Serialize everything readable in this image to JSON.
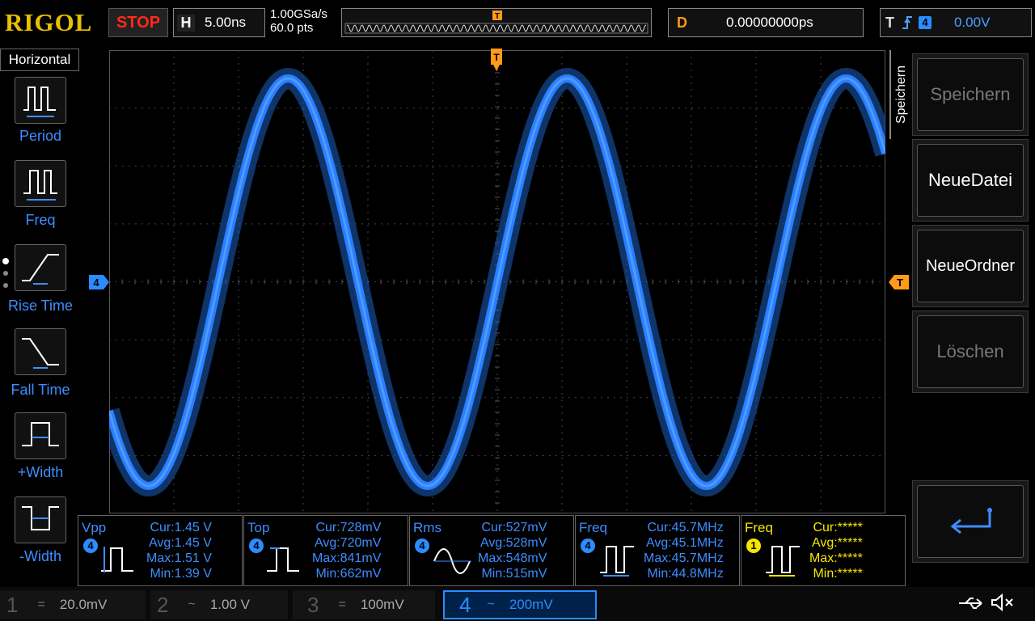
{
  "brand": "RIGOL",
  "run_state": "STOP",
  "horizontal": {
    "letter": "H",
    "timebase": "5.00ns"
  },
  "sample_rate": "1.00GSa/s",
  "memory_depth": "60.0  pts",
  "delay": {
    "letter": "D",
    "value": "0.00000000ps"
  },
  "trigger": {
    "letter": "T",
    "channel": "4",
    "level": "0.00V"
  },
  "left_menu": {
    "title": "Horizontal",
    "items": [
      {
        "label": "Period",
        "icon": "period-icon"
      },
      {
        "label": "Freq",
        "icon": "freq-icon"
      },
      {
        "label": "Rise Time",
        "icon": "rise-time-icon"
      },
      {
        "label": "Fall Time",
        "icon": "fall-time-icon"
      },
      {
        "label": "+Width",
        "icon": "pos-width-icon"
      },
      {
        "label": "-Width",
        "icon": "neg-width-icon"
      }
    ]
  },
  "channel_marker": "4",
  "trigger_marker": "T",
  "right_menu": {
    "title": "Speichern",
    "buttons": [
      {
        "label": "Speichern",
        "enabled": false
      },
      {
        "label": "NeueDatei",
        "enabled": true
      },
      {
        "label": "NeueOrdner",
        "enabled": true
      },
      {
        "label": "Löschen",
        "enabled": false
      }
    ],
    "back_icon": "enter-arrow-icon"
  },
  "measurements": [
    {
      "name": "Vpp",
      "channel": "4",
      "cur": "Cur:1.45 V",
      "avg": "Avg:1.45 V",
      "max": "Max:1.51 V",
      "min": "Min:1.39 V",
      "color": "#3e8dff",
      "icon": "vpp-icon"
    },
    {
      "name": "Top",
      "channel": "4",
      "cur": "Cur:728mV",
      "avg": "Avg:720mV",
      "max": "Max:841mV",
      "min": "Min:662mV",
      "color": "#3e8dff",
      "icon": "top-icon"
    },
    {
      "name": "Rms",
      "channel": "4",
      "cur": "Cur:527mV",
      "avg": "Avg:528mV",
      "max": "Max:548mV",
      "min": "Min:515mV",
      "color": "#3e8dff",
      "icon": "rms-icon"
    },
    {
      "name": "Freq",
      "channel": "4",
      "cur": "Cur:45.7MHz",
      "avg": "Avg:45.1MHz",
      "max": "Max:45.7MHz",
      "min": "Min:44.8MHz",
      "color": "#3e8dff",
      "icon": "freq-icon"
    },
    {
      "name": "Freq",
      "channel": "1",
      "cur": "Cur:*****",
      "avg": "Avg:*****",
      "max": "Max:*****",
      "min": "Min:*****",
      "color": "#f5e600",
      "icon": "freq-icon"
    }
  ],
  "channels": [
    {
      "num": "1",
      "coupling": "=",
      "scale": "20.0mV",
      "color": "#c8c000",
      "active": false
    },
    {
      "num": "2",
      "coupling": "~",
      "scale": "1.00 V",
      "color": "#00c8ff",
      "active": false
    },
    {
      "num": "3",
      "coupling": "=",
      "scale": "100mV",
      "color": "#c050c0",
      "active": false
    },
    {
      "num": "4",
      "coupling": "~",
      "scale": "200mV",
      "color": "#2b8cff",
      "active": true
    }
  ],
  "status_icons": [
    "usb-icon",
    "mute-icon"
  ],
  "colors": {
    "accent": "#2b8cff",
    "trigger": "#ff9a1a",
    "stop": "#ff2a1a",
    "brand": "#e8c100"
  }
}
